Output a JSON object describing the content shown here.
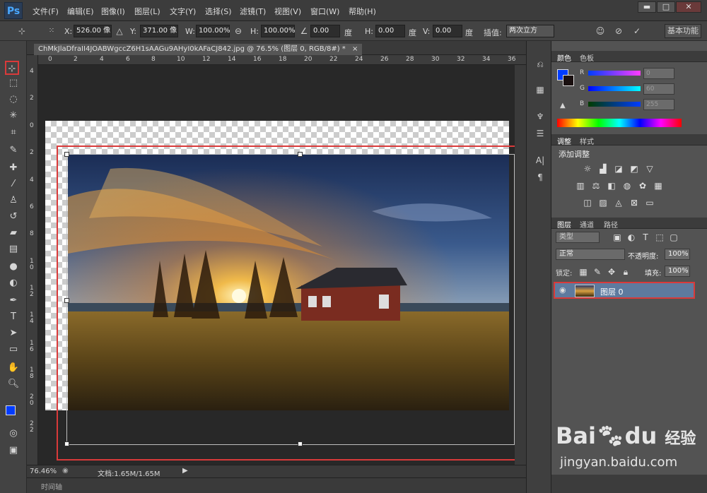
{
  "app": {
    "logo": "Ps"
  },
  "menu": [
    "文件(F)",
    "编辑(E)",
    "图像(I)",
    "图层(L)",
    "文字(Y)",
    "选择(S)",
    "滤镜(T)",
    "视图(V)",
    "窗口(W)",
    "帮助(H)"
  ],
  "window_buttons": {
    "minimize": "▬",
    "maximize": "□",
    "close": "✕"
  },
  "options": {
    "x_label": "X:",
    "x_value": "526.00 像",
    "y_label": "Y:",
    "y_value": "371.00 像",
    "w_label": "W:",
    "w_value": "100.00%",
    "h_label": "H:",
    "h_value": "100.00%",
    "angle_value": "0.00",
    "angle_unit": "度",
    "hskew_label": "H:",
    "hskew_value": "0.00",
    "hskew_unit": "度",
    "vskew_label": "V:",
    "vskew_value": "0.00",
    "vskew_unit": "度",
    "interp_label": "插值:",
    "interp_value": "两次立方",
    "workspace": "基本功能"
  },
  "document": {
    "tab_title": "ChMkJlaDfraII4JOABWgccZ6H1sAAGu9AHyI0kAFaCJ842.jpg @ 76.5% (图层 0, RGB/8#) *",
    "tab_close": "×"
  },
  "ruler_top": [
    "0",
    "2",
    "4",
    "6",
    "8",
    "10",
    "12",
    "14",
    "16",
    "18",
    "20",
    "22",
    "24",
    "26",
    "28",
    "30",
    "32",
    "34",
    "36"
  ],
  "ruler_left": [
    "4",
    "2",
    "0",
    "2",
    "4",
    "6",
    "8",
    "1\n0",
    "1\n2",
    "1\n4",
    "1\n6",
    "1\n8",
    "2\n0",
    "2\n2"
  ],
  "status": {
    "zoom": "76.46%",
    "doc": "文档:1.65M/1.65M"
  },
  "timeline": {
    "label": "时间轴"
  },
  "color_panel": {
    "tabs": [
      "颜色",
      "色板"
    ],
    "r_label": "R",
    "r_value": "0",
    "g_label": "G",
    "g_value": "60",
    "b_label": "B",
    "b_value": "255",
    "fg_color": "#003cff",
    "bg_color": "#1a1010"
  },
  "adjust_panel": {
    "tabs": [
      "调整",
      "样式"
    ],
    "title": "添加调整"
  },
  "layers_panel": {
    "tabs": [
      "图层",
      "通道",
      "路径"
    ],
    "filter_label": "类型",
    "blend_mode": "正常",
    "opacity_label": "不透明度:",
    "opacity_value": "100%",
    "lock_label": "锁定:",
    "fill_label": "填充:",
    "fill_value": "100%",
    "layer_name": "图层 0"
  },
  "watermark": {
    "brand": "Bai",
    "brand2": "du",
    "cn": "经验",
    "url": "jingyan.baidu.com"
  }
}
